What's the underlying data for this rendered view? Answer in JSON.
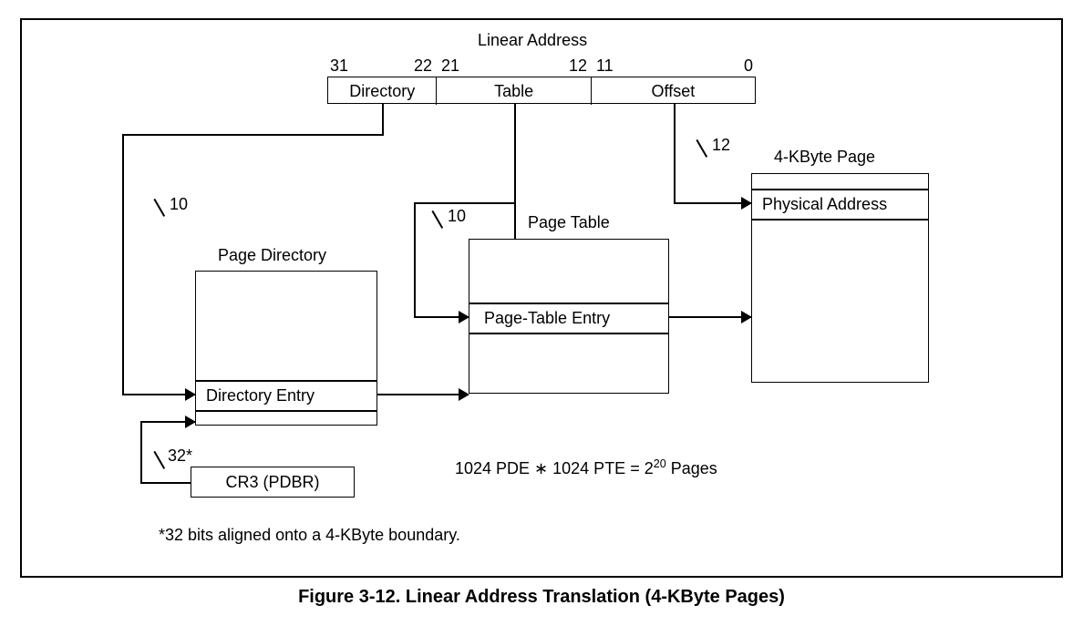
{
  "title": "Linear Address",
  "bits": {
    "b31": "31",
    "b22": "22",
    "b21": "21",
    "b12": "12",
    "b11": "11",
    "b0": "0"
  },
  "fields": {
    "directory": "Directory",
    "table": "Table",
    "offset": "Offset"
  },
  "widths": {
    "dir": "10",
    "tbl": "10",
    "off": "12",
    "cr3": "32*"
  },
  "pd": {
    "title": "Page Directory",
    "entry": "Directory Entry"
  },
  "pt": {
    "title": "Page Table",
    "entry": "Page-Table Entry"
  },
  "page": {
    "title": "4-KByte Page",
    "entry": "Physical Address"
  },
  "cr3": "CR3 (PDBR)",
  "formula_prefix": "1024 PDE ∗ 1024 PTE = 2",
  "formula_exp": "20",
  "formula_suffix": " Pages",
  "footnote": "*32 bits aligned onto a 4-KByte boundary.",
  "caption": "Figure 3-12.  Linear Address Translation (4-KByte Pages)"
}
